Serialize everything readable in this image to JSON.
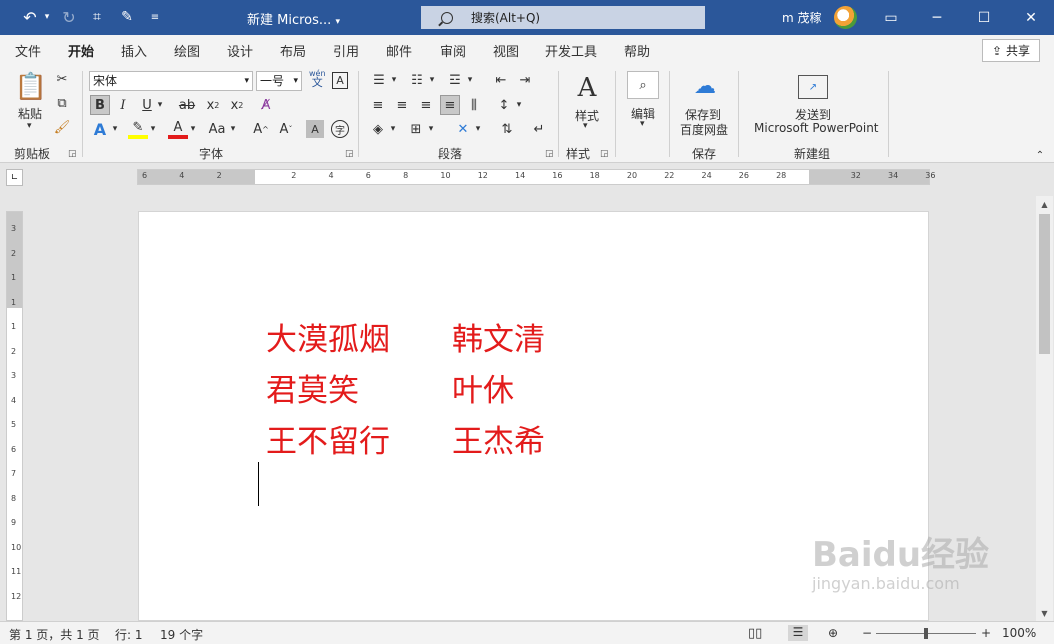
{
  "title_bar": {
    "doc_title": "新建 Micros...",
    "search_placeholder": "搜索(Alt+Q)",
    "user_name": "m 茂稼",
    "accent_color": "#2b579a"
  },
  "menu": {
    "items": [
      "文件",
      "开始",
      "插入",
      "绘图",
      "设计",
      "布局",
      "引用",
      "邮件",
      "审阅",
      "视图",
      "开发工具",
      "帮助"
    ],
    "active": "开始",
    "share_label": "共享"
  },
  "ribbon": {
    "clipboard": {
      "paste_label": "粘贴",
      "group_label": "剪贴板"
    },
    "font": {
      "font_name": "宋体",
      "font_size": "一号",
      "wen_label": "wén",
      "wen_char": "文",
      "group_label": "字体"
    },
    "paragraph": {
      "group_label": "段落"
    },
    "styles": {
      "label": "样式",
      "group_label": "样式"
    },
    "editing": {
      "label": "编辑"
    },
    "save": {
      "line1": "保存到",
      "line2": "百度网盘",
      "group_label": "保存"
    },
    "send": {
      "line1": "发送到",
      "line2": "Microsoft PowerPoint",
      "group_label": "新建组"
    }
  },
  "ruler": {
    "h_labels": [
      "6",
      "4",
      "2",
      "",
      "2",
      "4",
      "6",
      "8",
      "10",
      "12",
      "14",
      "16",
      "18",
      "20",
      "22",
      "24",
      "26",
      "28",
      "",
      "32",
      "34",
      "36"
    ],
    "v_labels": [
      "3",
      "2",
      "1",
      "1",
      "1",
      "2",
      "3",
      "4",
      "5",
      "6",
      "7",
      "8",
      "9",
      "10",
      "11",
      "12"
    ]
  },
  "document": {
    "text_color": "#e31b1b",
    "lines": [
      {
        "left": "大漠孤烟",
        "right": "韩文清"
      },
      {
        "left": "君莫笑",
        "right": "叶休"
      },
      {
        "left": "王不留行",
        "right": "王杰希"
      }
    ]
  },
  "status_bar": {
    "page": "第 1 页，共 1 页",
    "line": "行: 1",
    "words": "19 个字",
    "zoom": "100%"
  },
  "watermark": {
    "brand": "Baidu经验",
    "url": "jingyan.baidu.com"
  }
}
